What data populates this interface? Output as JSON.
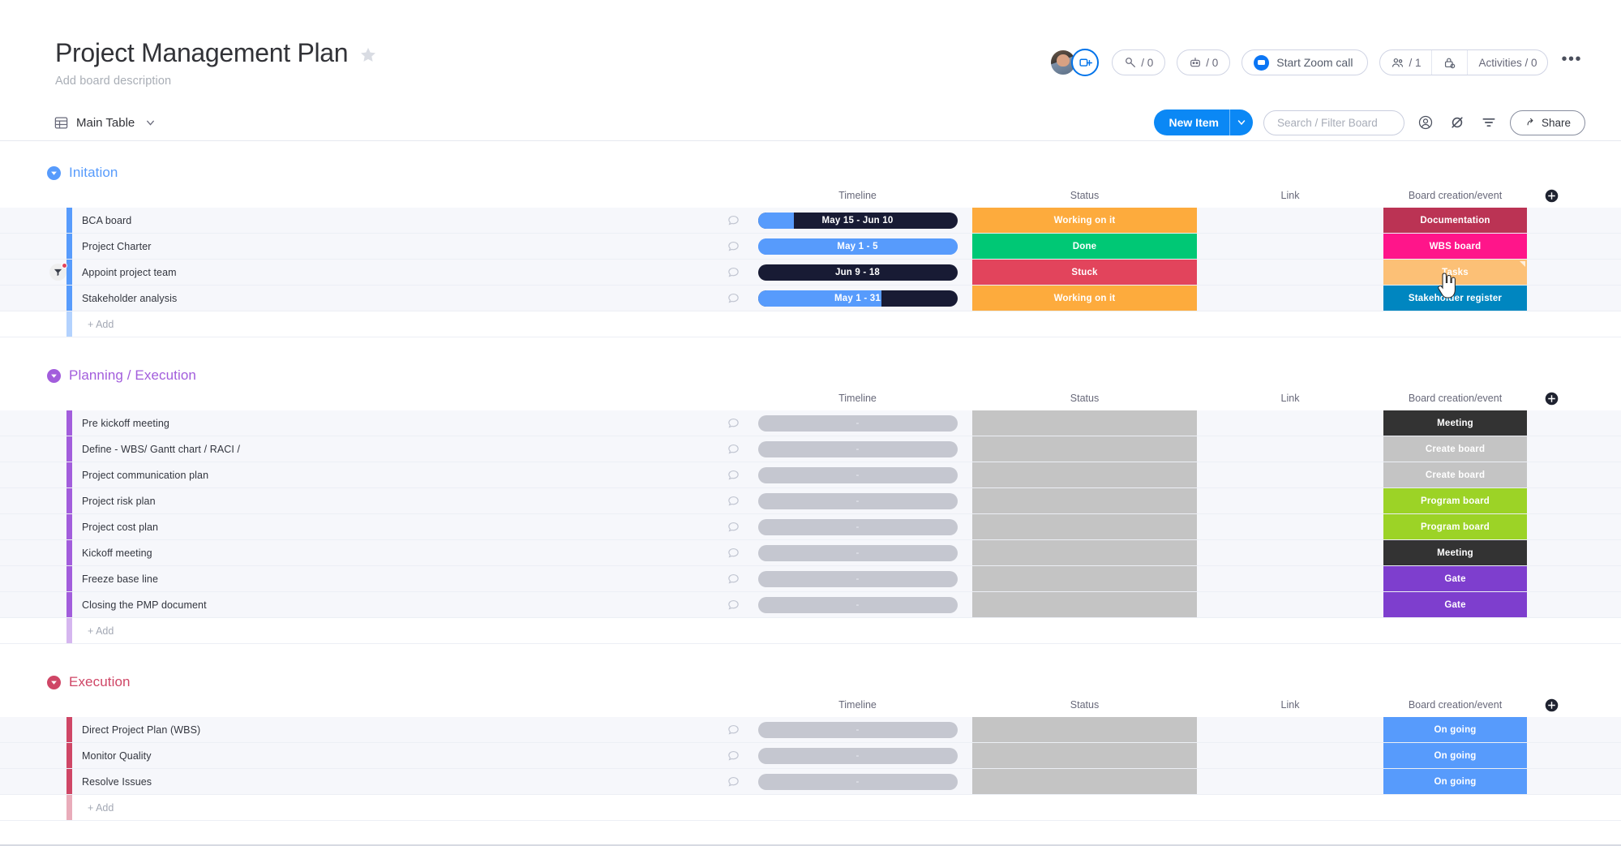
{
  "header": {
    "title": "Project Management Plan",
    "description": "Add board description",
    "star_icon": "star-icon",
    "avatar_name": "board-owner-avatar",
    "invite_icon": "invite-member-icon",
    "automations_count": "/ 0",
    "integrations_count": "/ 0",
    "zoom_button": "Start Zoom call",
    "members_count": "/ 1",
    "activities": "Activities / 0",
    "more_label": "•••"
  },
  "toolbar": {
    "view_label": "Main Table",
    "new_item_label": "New Item",
    "search_placeholder": "Search / Filter Board",
    "search_value": "",
    "share_label": "Share",
    "person_icon": "person-filter-icon",
    "hide_icon": "hide-icon",
    "sort_icon": "sort-icon"
  },
  "columns": {
    "timeline": "Timeline",
    "status": "Status",
    "link": "Link",
    "board_creation": "Board creation/event",
    "add_column": "add-column-icon"
  },
  "add_row_label": "+ Add",
  "colors": {
    "blue": "#579bfc",
    "purple": "#a25ddc",
    "crimson": "#cf4666",
    "orange": "#fdab3d",
    "green": "#00c875",
    "red": "#e2445c",
    "dark": "#181b34",
    "grey": "#c4c4c4",
    "accent_blue": "#0b88f5"
  },
  "groups": [
    {
      "name": "Initation",
      "color": "#579bfc",
      "rows": [
        {
          "name": "BCA board",
          "timeline": {
            "label": "May 15 - Jun 10",
            "progress": 18,
            "bg": "#181b34",
            "empty": false
          },
          "status": {
            "label": "Working on it",
            "color": "#fdab3d"
          },
          "link": "",
          "board_creation": {
            "label": "Documentation",
            "color": "#bb3354"
          }
        },
        {
          "name": "Project Charter",
          "timeline": {
            "label": "May 1 - 5",
            "progress": 100,
            "bg": "#579bfc",
            "empty": false
          },
          "status": {
            "label": "Done",
            "color": "#00c875"
          },
          "link": "",
          "board_creation": {
            "label": "WBS board",
            "color": "#ff158a"
          }
        },
        {
          "name": "Appoint project team",
          "timeline": {
            "label": "Jun 9 - 18",
            "progress": 0,
            "bg": "#181b34",
            "empty": false
          },
          "status": {
            "label": "Stuck",
            "color": "#e2445c"
          },
          "link": "",
          "board_creation": {
            "label": "Tasks",
            "color": "#fcc076"
          }
        },
        {
          "name": "Stakeholder analysis",
          "timeline": {
            "label": "May 1 - 31",
            "progress": 62,
            "bg": "#181b34",
            "empty": false
          },
          "status": {
            "label": "Working on it",
            "color": "#fdab3d"
          },
          "link": "",
          "board_creation": {
            "label": "Stakeholder register",
            "color": "#0086c0"
          }
        }
      ]
    },
    {
      "name": "Planning / Execution",
      "color": "#a25ddc",
      "rows": [
        {
          "name": "Pre kickoff meeting",
          "timeline": {
            "label": "-",
            "progress": 0,
            "bg": "#c5c7d0",
            "empty": true
          },
          "status": {
            "label": "",
            "color": "#c4c4c4"
          },
          "link": "",
          "board_creation": {
            "label": "Meeting",
            "color": "#333333"
          }
        },
        {
          "name": "Define - WBS/ Gantt chart / RACI /",
          "timeline": {
            "label": "-",
            "progress": 0,
            "bg": "#c5c7d0",
            "empty": true
          },
          "status": {
            "label": "",
            "color": "#c4c4c4"
          },
          "link": "",
          "board_creation": {
            "label": "Create board",
            "color": "#c4c4c4"
          }
        },
        {
          "name": "Project communication plan",
          "timeline": {
            "label": "-",
            "progress": 0,
            "bg": "#c5c7d0",
            "empty": true
          },
          "status": {
            "label": "",
            "color": "#c4c4c4"
          },
          "link": "",
          "board_creation": {
            "label": "Create board",
            "color": "#c4c4c4"
          }
        },
        {
          "name": "Project risk plan",
          "timeline": {
            "label": "-",
            "progress": 0,
            "bg": "#c5c7d0",
            "empty": true
          },
          "status": {
            "label": "",
            "color": "#c4c4c4"
          },
          "link": "",
          "board_creation": {
            "label": "Program board",
            "color": "#9cd326"
          }
        },
        {
          "name": "Project cost plan",
          "timeline": {
            "label": "-",
            "progress": 0,
            "bg": "#c5c7d0",
            "empty": true
          },
          "status": {
            "label": "",
            "color": "#c4c4c4"
          },
          "link": "",
          "board_creation": {
            "label": "Program board",
            "color": "#9cd326"
          }
        },
        {
          "name": "Kickoff meeting",
          "timeline": {
            "label": "-",
            "progress": 0,
            "bg": "#c5c7d0",
            "empty": true
          },
          "status": {
            "label": "",
            "color": "#c4c4c4"
          },
          "link": "",
          "board_creation": {
            "label": "Meeting",
            "color": "#333333"
          }
        },
        {
          "name": "Freeze base line",
          "timeline": {
            "label": "-",
            "progress": 0,
            "bg": "#c5c7d0",
            "empty": true
          },
          "status": {
            "label": "",
            "color": "#c4c4c4"
          },
          "link": "",
          "board_creation": {
            "label": "Gate",
            "color": "#7e3ece"
          }
        },
        {
          "name": "Closing the PMP document",
          "timeline": {
            "label": "-",
            "progress": 0,
            "bg": "#c5c7d0",
            "empty": true
          },
          "status": {
            "label": "",
            "color": "#c4c4c4"
          },
          "link": "",
          "board_creation": {
            "label": "Gate",
            "color": "#7e3ece"
          }
        }
      ]
    },
    {
      "name": "Execution",
      "color": "#cf4666",
      "rows": [
        {
          "name": "Direct Project Plan (WBS)",
          "timeline": {
            "label": "-",
            "progress": 0,
            "bg": "#c5c7d0",
            "empty": true
          },
          "status": {
            "label": "",
            "color": "#c4c4c4"
          },
          "link": "",
          "board_creation": {
            "label": "On going",
            "color": "#579bfc"
          }
        },
        {
          "name": "Monitor Quality",
          "timeline": {
            "label": "-",
            "progress": 0,
            "bg": "#c5c7d0",
            "empty": true
          },
          "status": {
            "label": "",
            "color": "#c4c4c4"
          },
          "link": "",
          "board_creation": {
            "label": "On going",
            "color": "#579bfc"
          }
        },
        {
          "name": "Resolve Issues",
          "timeline": {
            "label": "-",
            "progress": 0,
            "bg": "#c5c7d0",
            "empty": true
          },
          "status": {
            "label": "",
            "color": "#c4c4c4"
          },
          "link": "",
          "board_creation": {
            "label": "On going",
            "color": "#579bfc"
          }
        }
      ]
    }
  ]
}
